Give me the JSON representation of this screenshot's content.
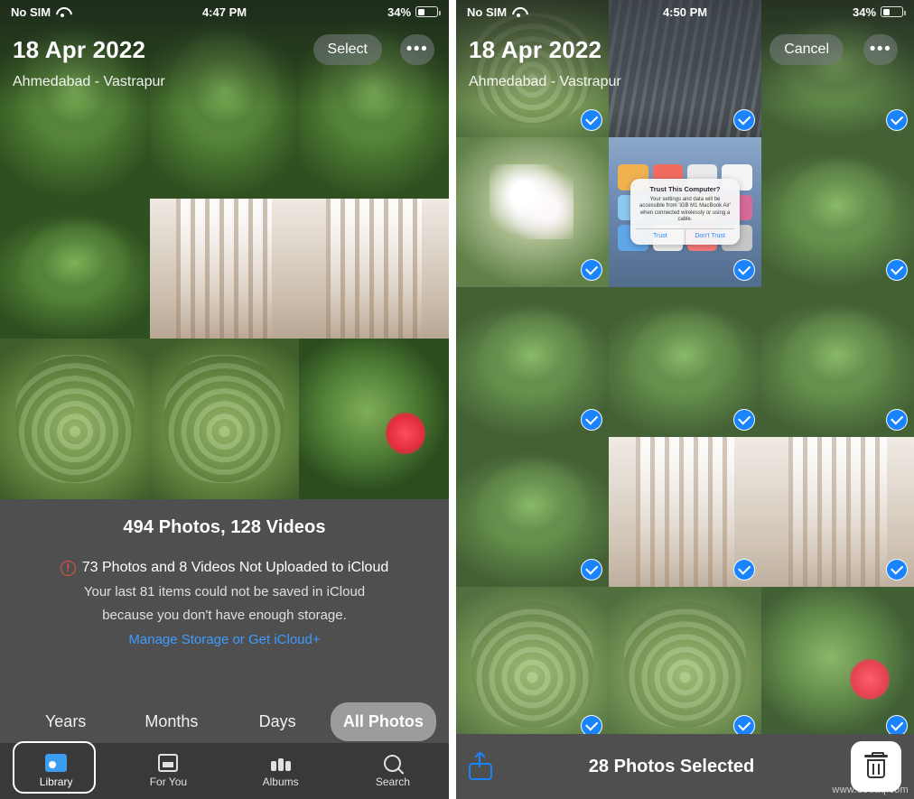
{
  "left": {
    "status": {
      "carrier": "No SIM",
      "wifi_icon": "wifi-icon",
      "time": "4:47 PM",
      "battery_pct": "34%",
      "battery_icon": "battery-icon"
    },
    "header": {
      "title": "18 Apr 2022",
      "subtitle": "Ahmedabad - Vastrapur",
      "select_label": "Select",
      "more_label": "•••"
    },
    "info": {
      "count": "494 Photos, 128 Videos",
      "warning": "73 Photos and 8 Videos Not Uploaded to iCloud",
      "warning_icon": "exclamation-circle-icon",
      "detail_line_1": "Your last 81 items could not be saved in iCloud",
      "detail_line_2": "because you don't have enough storage.",
      "link": "Manage Storage or Get iCloud+"
    },
    "segments": [
      {
        "label": "Years",
        "active": false
      },
      {
        "label": "Months",
        "active": false
      },
      {
        "label": "Days",
        "active": false
      },
      {
        "label": "All Photos",
        "active": true
      }
    ],
    "tabs": [
      {
        "label": "Library",
        "icon": "photo-library-icon",
        "active": true
      },
      {
        "label": "For You",
        "icon": "for-you-icon",
        "active": false
      },
      {
        "label": "Albums",
        "icon": "albums-icon",
        "active": false
      },
      {
        "label": "Search",
        "icon": "search-icon",
        "active": false
      }
    ],
    "photos": [
      {
        "kind": "leaf",
        "alt": "potted leaf plant"
      },
      {
        "kind": "leaf",
        "alt": "potted leaf plant"
      },
      {
        "kind": "leaf",
        "alt": "potted leaf plant"
      },
      {
        "kind": "leaf",
        "alt": "potted leaf plant"
      },
      {
        "kind": "hall",
        "alt": "corridor"
      },
      {
        "kind": "hall",
        "alt": "corridor"
      },
      {
        "kind": "succ",
        "alt": "green plants"
      },
      {
        "kind": "succ",
        "alt": "green plants"
      },
      {
        "kind": "flower",
        "alt": "red flower plant"
      }
    ]
  },
  "right": {
    "status": {
      "carrier": "No SIM",
      "wifi_icon": "wifi-icon",
      "time": "4:50 PM",
      "battery_pct": "34%",
      "battery_icon": "battery-icon"
    },
    "header": {
      "title": "18 Apr 2022",
      "subtitle": "Ahmedabad - Vastrapur",
      "cancel_label": "Cancel",
      "more_label": "•••"
    },
    "selection_bar": {
      "share_icon": "share-icon",
      "title": "28 Photos Selected",
      "delete_icon": "trash-icon"
    },
    "trust_dialog": {
      "title": "Trust This Computer?",
      "body": "Your settings and data will be accessible from 'iGB M1 MacBook Air' when connected wirelessly or using a cable.",
      "trust_label": "Trust",
      "dont_trust_label": "Don't Trust"
    },
    "photos": [
      {
        "kind": "succ",
        "selected": true
      },
      {
        "kind": "building",
        "selected": true
      },
      {
        "kind": "leaf",
        "selected": true
      },
      {
        "kind": "white-flower",
        "selected": true
      },
      {
        "kind": "home",
        "selected": true
      },
      {
        "kind": "leaf",
        "selected": true
      },
      {
        "kind": "leaf",
        "selected": true
      },
      {
        "kind": "leaf",
        "selected": true
      },
      {
        "kind": "leaf",
        "selected": true
      },
      {
        "kind": "leaf",
        "selected": true
      },
      {
        "kind": "hall",
        "selected": true
      },
      {
        "kind": "hall",
        "selected": true
      },
      {
        "kind": "succ",
        "selected": true
      },
      {
        "kind": "succ",
        "selected": true
      },
      {
        "kind": "flower",
        "selected": true
      }
    ]
  },
  "watermark": "www.deuaq.com",
  "colors": {
    "accent_blue": "#1a84ff",
    "link_blue": "#3e9bff",
    "warning_red": "#e8503a",
    "panel_gray": "#4f4f4f"
  }
}
